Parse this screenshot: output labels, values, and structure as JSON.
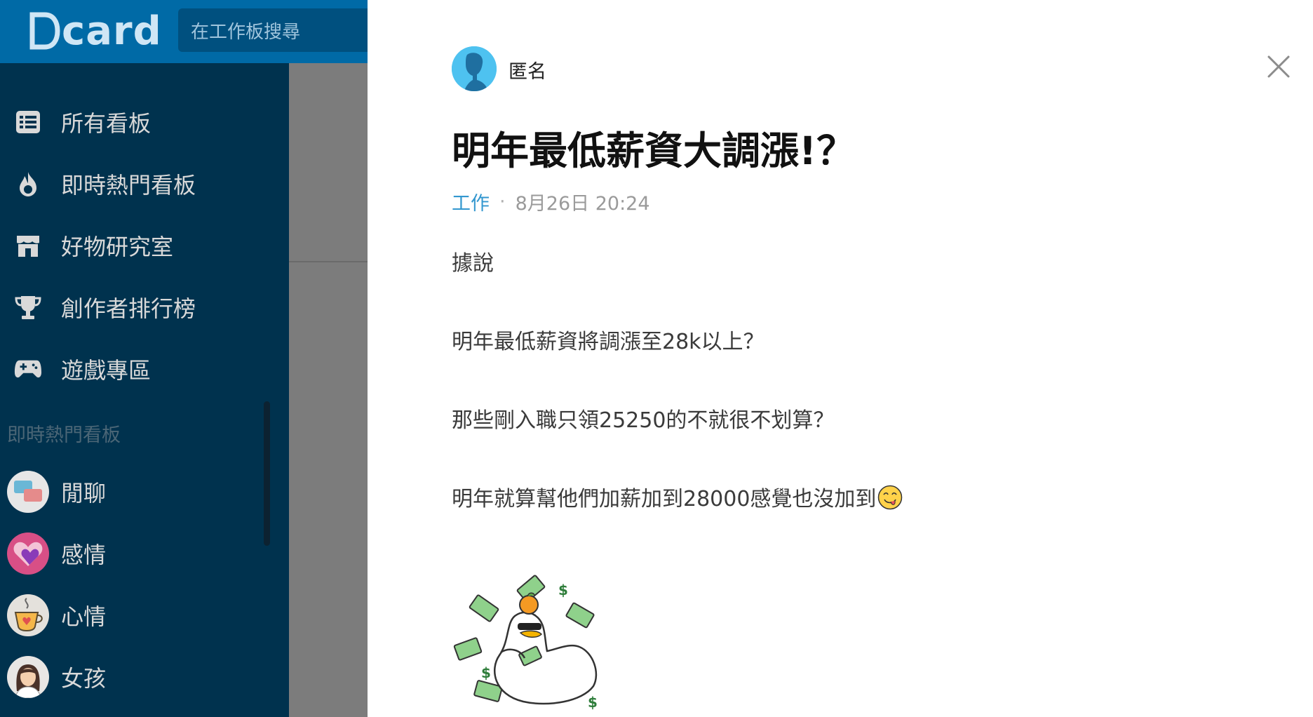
{
  "header": {
    "logo_text": "card",
    "search_placeholder": "在工作板搜尋"
  },
  "sidebar": {
    "items": [
      {
        "label": "所有看板",
        "icon": "list-icon"
      },
      {
        "label": "即時熱門看板",
        "icon": "fire-icon"
      },
      {
        "label": "好物研究室",
        "icon": "store-icon"
      },
      {
        "label": "創作者排行榜",
        "icon": "trophy-icon"
      },
      {
        "label": "遊戲專區",
        "icon": "gamepad-icon"
      }
    ],
    "section_heading": "即時熱門看板",
    "boards": [
      {
        "label": "閒聊",
        "icon": "chat-bubbles-icon"
      },
      {
        "label": "感情",
        "icon": "heart-icon"
      },
      {
        "label": "心情",
        "icon": "coffee-cup-icon"
      },
      {
        "label": "女孩",
        "icon": "girl-icon"
      }
    ]
  },
  "post": {
    "author": "匿名",
    "title": "明年最低薪資大調漲!？",
    "forum": "工作",
    "separator": "·",
    "time": "8月26日 20:24",
    "body": [
      "據說",
      "明年最低薪資將調漲至28k以上？",
      "那些剛入職只領25250的不就很不划算？",
      "明年就算幫他們加薪加到28000感覺也沒加到"
    ],
    "emoji": "yum-face-emoji",
    "sticker": "duck-money-sticker"
  },
  "colors": {
    "topbar": "#006aa6",
    "sidebar": "#00324e",
    "forum_link": "#3397cf"
  }
}
